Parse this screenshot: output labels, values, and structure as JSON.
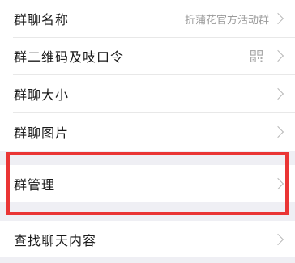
{
  "settings": {
    "group1": [
      {
        "label": "群聊名称",
        "value": "折蒲花官方活动群",
        "icon": "chevron-right-icon"
      },
      {
        "label": "群二维码及吱口令",
        "icon": "qr-code-icon"
      },
      {
        "label": "群聊大小",
        "icon": "chevron-right-icon"
      },
      {
        "label": "群聊图片",
        "icon": "chevron-right-icon"
      }
    ],
    "group2": [
      {
        "label": "群管理",
        "icon": "chevron-right-icon"
      }
    ],
    "group3": [
      {
        "label": "查找聊天内容",
        "icon": "chevron-right-icon"
      }
    ]
  },
  "colors": {
    "highlight_border": "#ea3535",
    "background": "#efeff4",
    "row_background": "#ffffff"
  }
}
